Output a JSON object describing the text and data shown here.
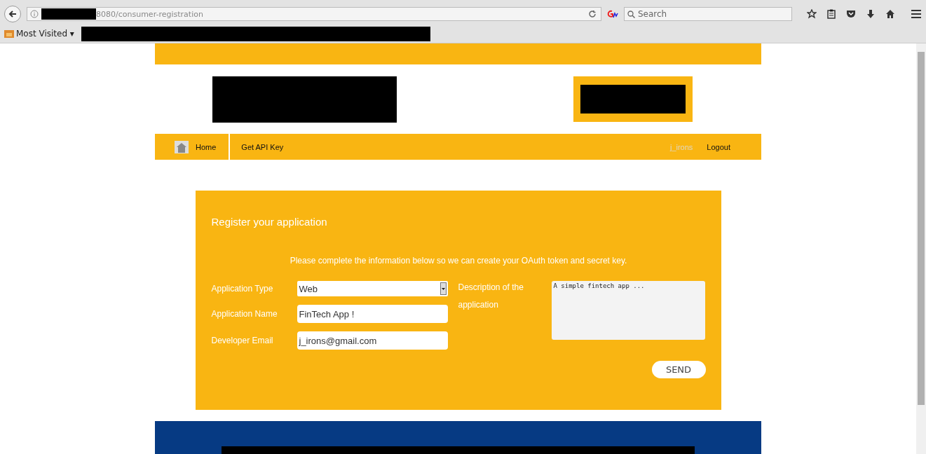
{
  "browser": {
    "url": "8080/consumer-registration",
    "search_placeholder": "Search",
    "bookmarks": [
      "Most Visited ▾"
    ]
  },
  "nav": {
    "items": [
      {
        "label": "Home",
        "kind": "home"
      },
      {
        "label": "Get API Key",
        "kind": "link"
      }
    ],
    "user": "j_irons",
    "logout": "Logout"
  },
  "form": {
    "title": "Register your application",
    "intro": "Please complete the information below so we can create your OAuth token and secret key.",
    "fields": [
      {
        "label": "Application Type",
        "kind": "select",
        "value": "Web"
      },
      {
        "label": "Application Name",
        "kind": "text",
        "value": "FinTech App !"
      },
      {
        "label": "Developer Email",
        "kind": "text",
        "value": "j_irons@gmail.com"
      }
    ],
    "description": {
      "label": "Description of the application",
      "value": "A simple fintech app ..."
    },
    "submit": "SEND"
  }
}
